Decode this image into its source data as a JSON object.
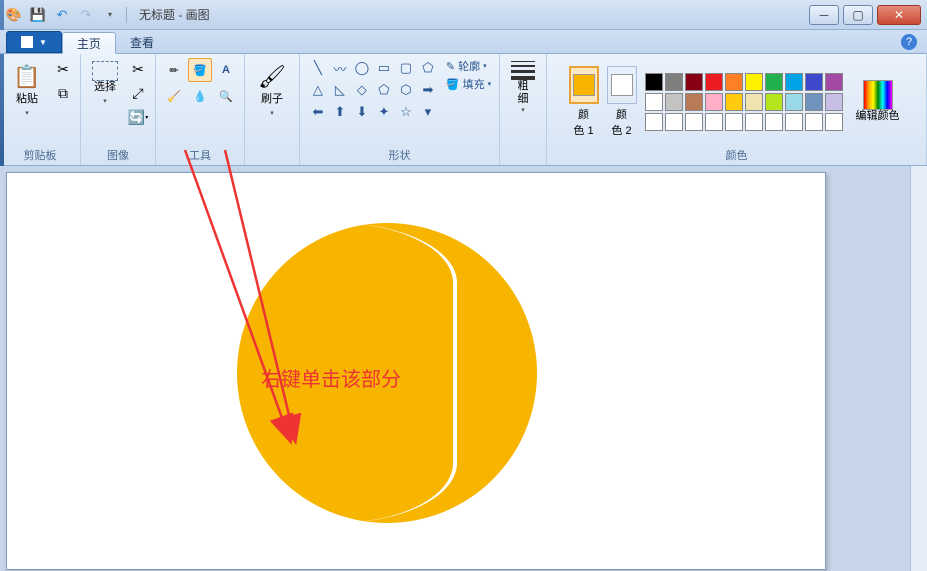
{
  "titlebar": {
    "title": "无标题 - 画图",
    "qat_tooltip_save": "保存",
    "qat_tooltip_undo": "撤销",
    "qat_tooltip_redo": "重做"
  },
  "tabs": {
    "file_label": "",
    "home_label": "主页",
    "view_label": "查看"
  },
  "ribbon": {
    "clipboard": {
      "paste_label": "粘贴",
      "group_label": "剪贴板"
    },
    "image": {
      "select_label": "选择",
      "group_label": "图像"
    },
    "tools": {
      "group_label": "工具"
    },
    "brushes": {
      "brush_label": "刷子"
    },
    "shapes": {
      "outline_label": "轮廓",
      "fill_label": "填充",
      "group_label": "形状"
    },
    "size": {
      "label": "粗\n细"
    },
    "colors": {
      "color1_label": "颜\n色 1",
      "color2_label": "颜\n色 2",
      "edit_label": "编辑颜色",
      "group_label": "颜色",
      "color1_value": "#f7b500",
      "color2_value": "#ffffff",
      "palette": [
        "#000000",
        "#7f7f7f",
        "#880015",
        "#ed1c24",
        "#ff7f27",
        "#fff200",
        "#22b14c",
        "#00a2e8",
        "#3f48cc",
        "#a349a4",
        "#ffffff",
        "#c3c3c3",
        "#b97a57",
        "#ffaec9",
        "#ffc90e",
        "#efe4b0",
        "#b5e61d",
        "#99d9ea",
        "#7092be",
        "#c8bfe7",
        "#ffffff",
        "#ffffff",
        "#ffffff",
        "#ffffff",
        "#ffffff",
        "#ffffff",
        "#ffffff",
        "#ffffff",
        "#ffffff",
        "#ffffff"
      ]
    }
  },
  "canvas": {
    "annotation_text": "右键单击该部分"
  }
}
